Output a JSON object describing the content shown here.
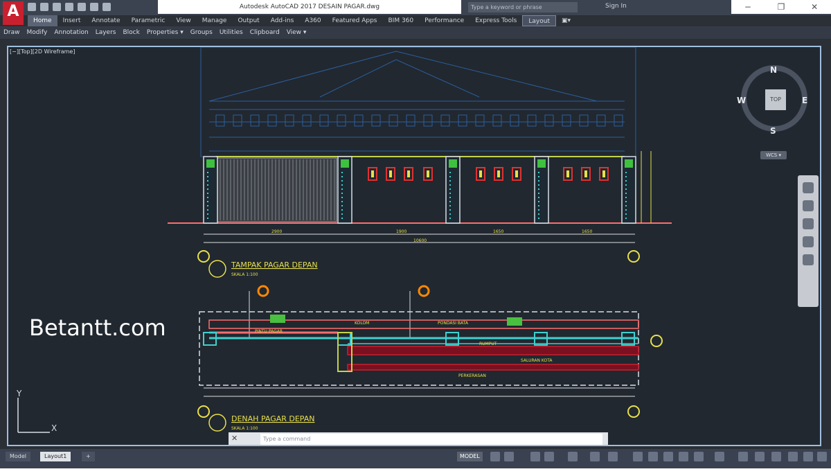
{
  "titlebar": {
    "logo": "A",
    "app_title": "Autodesk AutoCAD 2017    DESAIN PAGAR.dwg",
    "search_placeholder": "Type a keyword or phrase",
    "sign_in": "Sign In",
    "win_minimize": "−",
    "win_restore": "❐",
    "win_close": "✕"
  },
  "ribbon_tabs": [
    "Home",
    "Insert",
    "Annotate",
    "Parametric",
    "View",
    "Manage",
    "Output",
    "Add-ins",
    "A360",
    "Featured Apps",
    "BIM 360",
    "Performance",
    "Express Tools",
    "Layout",
    "▣▾"
  ],
  "ribbon_panels": [
    "Draw",
    "Modify",
    "Annotation",
    "Layers",
    "Block",
    "Properties ▾",
    "Groups",
    "Utilities",
    "Clipboard",
    "View ▾"
  ],
  "viewport": {
    "label": "[−][Top][2D Wireframe]",
    "watermark": "Betantt.com",
    "title1": "TAMPAK PAGAR DEPAN",
    "scale1": "SKALA 1:100",
    "title2": "DENAH PAGAR DEPAN",
    "scale2": "SKALA 1:100",
    "label_saluran": "SALURAN KOTA",
    "label_rumput": "RUMPUT",
    "label_perkerasan": "PERKERASAN",
    "label_pintu": "PINTU PAGAR",
    "label_kolom": "KOLOM",
    "label_pondasi": "PONDASI BATA"
  },
  "viewcube": {
    "top": "TOP",
    "north": "N",
    "south": "S",
    "east": "E",
    "west": "W",
    "wcs": "WCS ▾"
  },
  "ucs": {
    "x": "X",
    "y": "Y"
  },
  "command": {
    "close": "✕",
    "placeholder": "Type a command"
  },
  "status": {
    "tab_model": "Model",
    "tab_layout1": "Layout1",
    "tab_add": "+",
    "model_button": "MODEL"
  }
}
